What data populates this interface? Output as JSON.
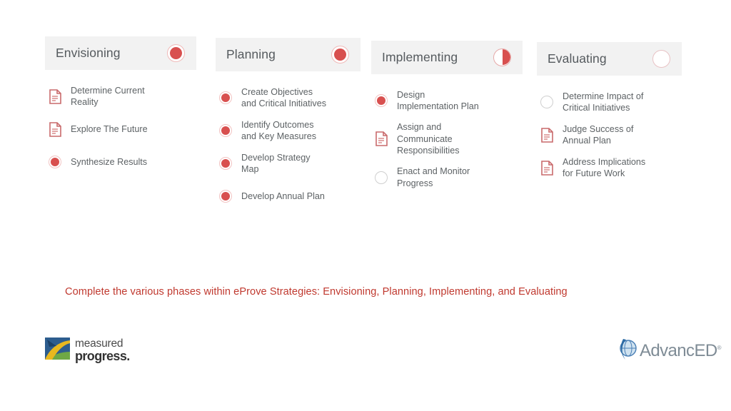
{
  "colors": {
    "accent_red": "#d8504f",
    "caption_red": "#c0392f",
    "header_bg": "#f2f2f2",
    "title_gray": "#555a5e",
    "label_gray": "#5d6265"
  },
  "phases": [
    {
      "title": "Envisioning",
      "status_icon": "filled-circle-icon",
      "status": "full",
      "tasks": [
        {
          "label": "Determine Current\nReality",
          "icon": "document-icon",
          "icon_type": "doc"
        },
        {
          "label": "Explore The Future",
          "icon": "document-icon",
          "icon_type": "doc"
        },
        {
          "label": "Synthesize Results",
          "icon": "filled-circle-icon",
          "icon_type": "full"
        }
      ]
    },
    {
      "title": "Planning",
      "status_icon": "filled-circle-icon",
      "status": "full",
      "tasks": [
        {
          "label": "Create Objectives\nand Critical Initiatives",
          "icon": "filled-circle-icon",
          "icon_type": "full"
        },
        {
          "label": "Identify Outcomes\nand Key Measures",
          "icon": "filled-circle-icon",
          "icon_type": "full"
        },
        {
          "label": "Develop Strategy\nMap",
          "icon": "filled-circle-icon",
          "icon_type": "full"
        },
        {
          "label": "Develop Annual Plan",
          "icon": "filled-circle-icon",
          "icon_type": "full"
        }
      ]
    },
    {
      "title": "Implementing",
      "status_icon": "half-filled-circle-icon",
      "status": "half",
      "tasks": [
        {
          "label": "Design\nImplementation Plan",
          "icon": "filled-circle-icon",
          "icon_type": "full"
        },
        {
          "label": "Assign and\nCommunicate\nResponsibilities",
          "icon": "document-icon",
          "icon_type": "doc"
        },
        {
          "label": "Enact and Monitor\nProgress",
          "icon": "empty-circle-icon",
          "icon_type": "empty"
        }
      ]
    },
    {
      "title": "Evaluating",
      "status_icon": "empty-circle-icon",
      "status": "empty",
      "tasks": [
        {
          "label": "Determine Impact of\nCritical Initiatives",
          "icon": "empty-circle-icon",
          "icon_type": "empty"
        },
        {
          "label": "Judge Success of\nAnnual Plan",
          "icon": "document-icon",
          "icon_type": "doc"
        },
        {
          "label": "Address Implications\nfor Future Work",
          "icon": "document-icon",
          "icon_type": "doc"
        }
      ]
    }
  ],
  "caption": "Complete the various phases within eProve Strategies:  Envisioning, Planning, Implementing, and Evaluating",
  "logos": {
    "measured_progress": {
      "line1": "measured",
      "line2": "progress.",
      "mark": "measured-progress-mark-icon"
    },
    "advanced": {
      "text": "AdvancED",
      "registered": "®",
      "mark": "advanced-globe-mark-icon"
    }
  }
}
